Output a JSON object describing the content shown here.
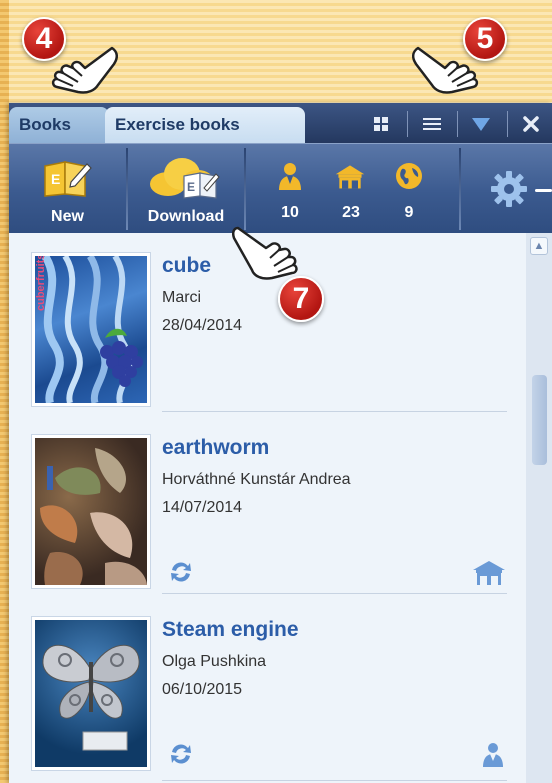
{
  "window": {
    "tabs": [
      {
        "label": "Books",
        "active": false
      },
      {
        "label": "Exercise books",
        "active": true
      }
    ],
    "tabbar_icons": [
      "grid-view-icon",
      "list-view-icon",
      "dropdown-arrow-icon",
      "close-icon"
    ]
  },
  "toolbar": {
    "new_label": "New",
    "download_label": "Download",
    "stats": [
      {
        "icon": "person-icon",
        "count": "10",
        "color": "#f2b82a"
      },
      {
        "icon": "house-icon",
        "count": "23",
        "color": "#f2b82a"
      },
      {
        "icon": "globe-icon",
        "count": "9",
        "color": "#f2b82a"
      }
    ],
    "settings_icon": "gear-icon"
  },
  "callouts": [
    "4",
    "5",
    "7"
  ],
  "books": [
    {
      "title": "cube",
      "author": "Marci",
      "date": "28/04/2014",
      "cover_text": "cuberfruits",
      "icons": []
    },
    {
      "title": "earthworm",
      "author": "Horváthné Kunstár Andrea",
      "date": "14/07/2014",
      "icons": [
        "sync-icon",
        "house-icon"
      ]
    },
    {
      "title": "Steam engine",
      "author": "Olga Pushkina",
      "date": "06/10/2015",
      "icons": [
        "sync-icon",
        "person-icon"
      ]
    }
  ],
  "colors": {
    "accent": "#2c5da8",
    "toolbar": "#3b5a8f",
    "icon_gold": "#f2b82a",
    "icon_blue": "#5b8fd0",
    "callout_red": "#c81e18"
  }
}
